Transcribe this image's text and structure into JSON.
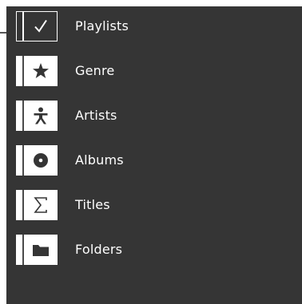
{
  "menu": {
    "items": [
      {
        "label": "Playlists",
        "icon": "checkmark-icon",
        "selected": true
      },
      {
        "label": "Genre",
        "icon": "star-icon",
        "selected": false
      },
      {
        "label": "Artists",
        "icon": "person-icon",
        "selected": false
      },
      {
        "label": "Albums",
        "icon": "disc-icon",
        "selected": false
      },
      {
        "label": "Titles",
        "icon": "sigma-icon",
        "selected": false
      },
      {
        "label": "Folders",
        "icon": "folder-icon",
        "selected": false
      }
    ]
  },
  "colors": {
    "panel_background": "#353535",
    "tile_background": "#ffffff",
    "text": "#ffffff",
    "icon": "#353535"
  }
}
